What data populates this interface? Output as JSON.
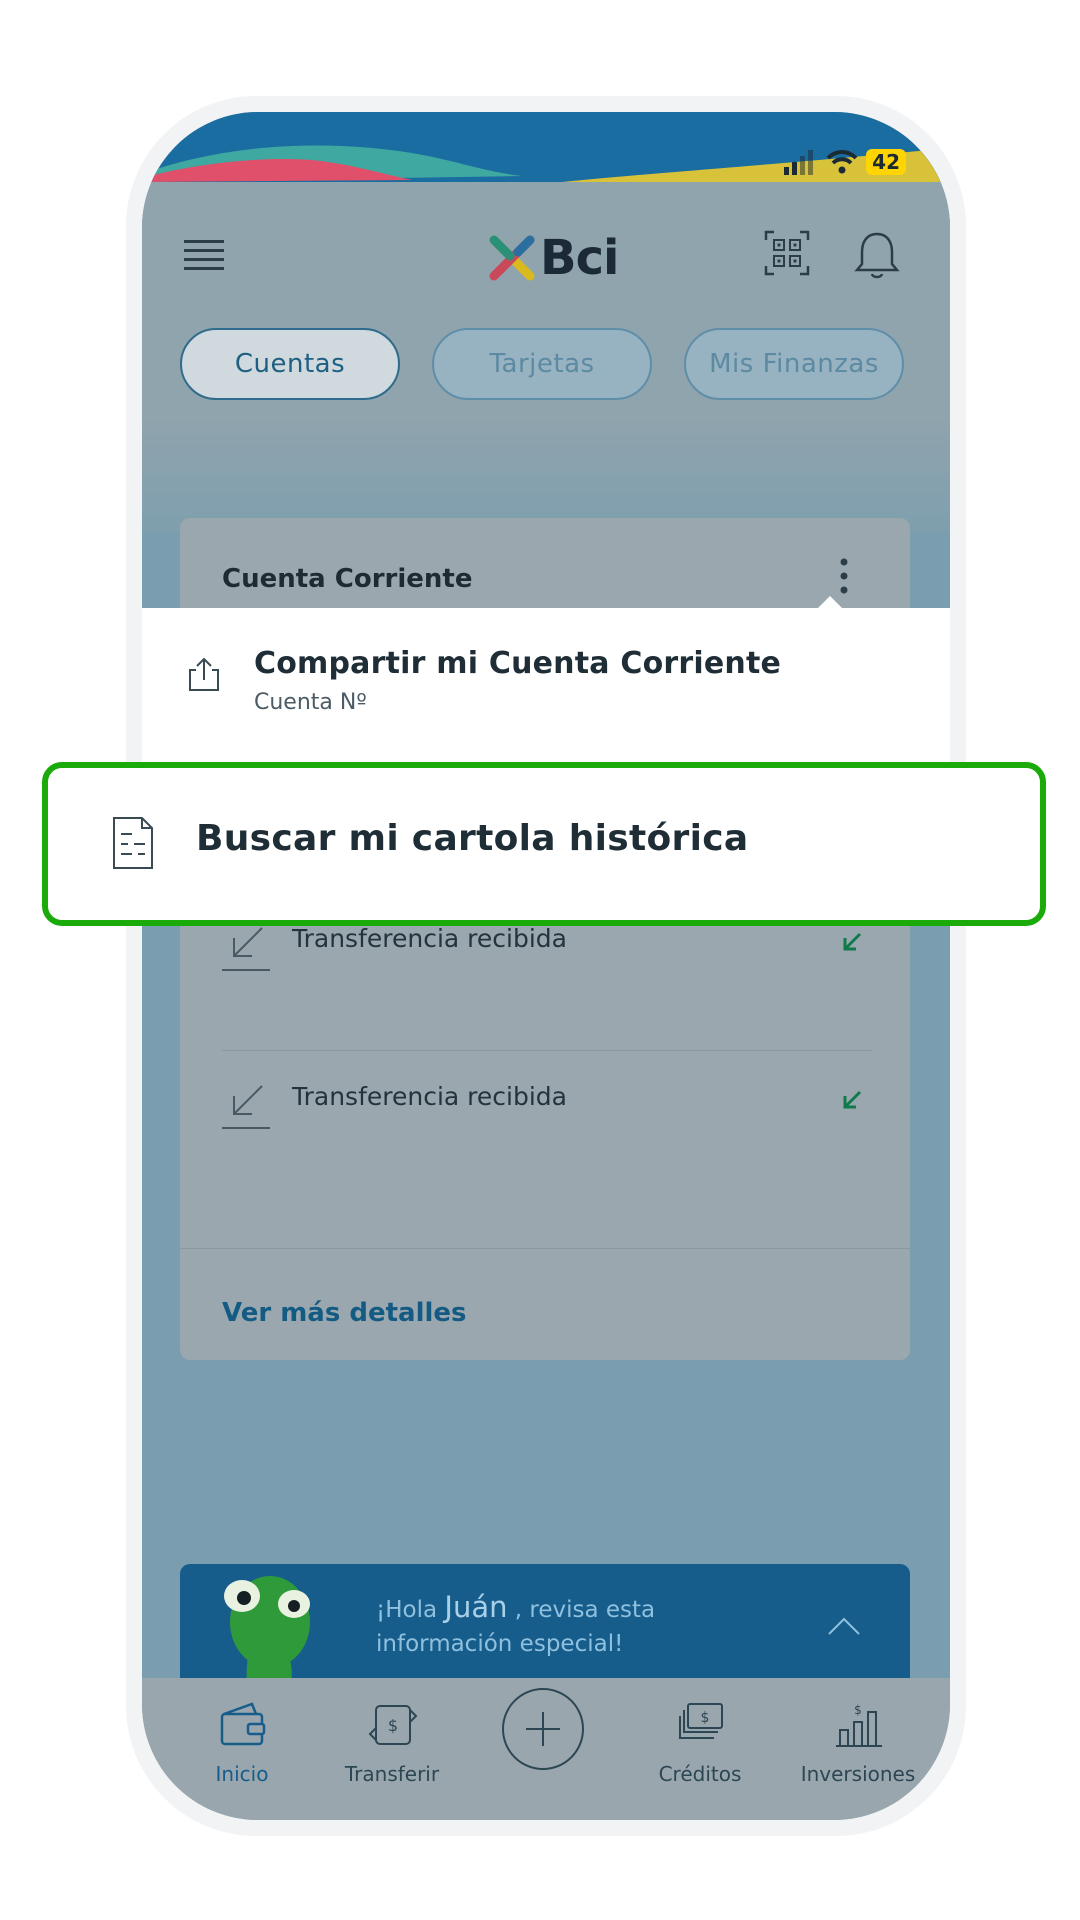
{
  "status_bar": {
    "battery": "42"
  },
  "header": {
    "logo_text": "Bci",
    "menu_icon": "hamburger-icon",
    "qr_icon": "qr-code-icon",
    "bell_icon": "bell-icon"
  },
  "tabs": [
    {
      "label": "Cuentas",
      "active": true
    },
    {
      "label": "Tarjetas",
      "active": false
    },
    {
      "label": "Mis Finanzas",
      "active": false
    }
  ],
  "account_card": {
    "title": "Cuenta Corriente",
    "transactions": [
      {
        "label": "Transferencia recibida"
      },
      {
        "label": "Transferencia recibida"
      }
    ],
    "details_link": "Ver más detalles"
  },
  "popup_menu": {
    "share_title": "Compartir mi Cuenta Corriente",
    "share_subtitle": "Cuenta Nº",
    "history_label": "Buscar mi cartola histórica"
  },
  "promo": {
    "greeting_prefix": "¡Hola",
    "name": "Juán",
    "greeting_suffix": ", revisa esta",
    "line2": "información especial!"
  },
  "bottom_nav": [
    {
      "label": "Inicio",
      "icon": "wallet-icon",
      "active": true
    },
    {
      "label": "Transferir",
      "icon": "transfer-icon",
      "active": false
    },
    {
      "label": "",
      "icon": "plus-icon",
      "active": false
    },
    {
      "label": "Créditos",
      "icon": "credits-icon",
      "active": false
    },
    {
      "label": "Inversiones",
      "icon": "investments-icon",
      "active": false
    }
  ],
  "colors": {
    "highlight": "#1aab0a",
    "brand_blue": "#175d8c"
  }
}
